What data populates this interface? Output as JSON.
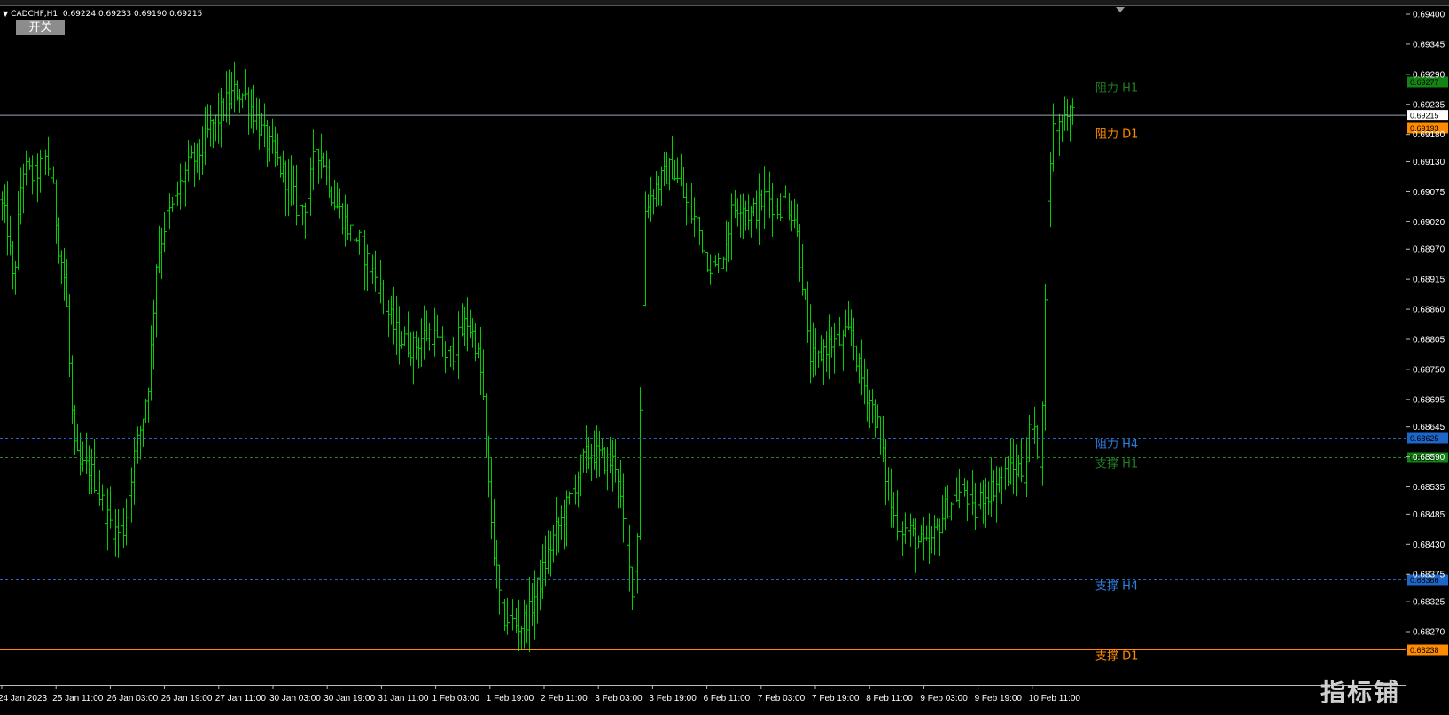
{
  "chart_header": {
    "symbol": "CADCHF,H1",
    "ohlc": "0.69224 0.69233 0.69190 0.69215",
    "toggle_label": "开关"
  },
  "watermark_text": "指标铺",
  "chart_data": {
    "type": "ohlc",
    "title": "CADCHF,H1",
    "ylim": [
      0.68175,
      0.69405
    ],
    "y_ticks": [
      "0.69400",
      "0.69345",
      "0.69290",
      "0.69235",
      "0.69180",
      "0.69130",
      "0.69075",
      "0.69020",
      "0.68970",
      "0.68915",
      "0.68860",
      "0.68805",
      "0.68750",
      "0.68695",
      "0.68645",
      "0.68590",
      "0.68535",
      "0.68485",
      "0.68430",
      "0.68375",
      "0.68325",
      "0.68270"
    ],
    "x_ticks": [
      "24 Jan 2023",
      "25 Jan 11:00",
      "26 Jan 03:00",
      "26 Jan 19:00",
      "27 Jan 11:00",
      "30 Jan 03:00",
      "30 Jan 19:00",
      "31 Jan 11:00",
      "1 Feb 03:00",
      "1 Feb 19:00",
      "2 Feb 11:00",
      "3 Feb 03:00",
      "3 Feb 19:00",
      "6 Feb 11:00",
      "7 Feb 03:00",
      "7 Feb 19:00",
      "8 Feb 11:00",
      "9 Feb 03:00",
      "9 Feb 19:00",
      "10 Feb 11:00"
    ],
    "current_price": "0.69215",
    "levels": [
      {
        "name": "阻力 H1",
        "value": "0.69277",
        "color": "#1e8a1e",
        "style": "dashed",
        "label_color": "#1f7f1f",
        "box_color": "#148214"
      },
      {
        "name": "阻力 D1",
        "value": "0.69193",
        "color": "#ff8c00",
        "style": "solid",
        "label_color": "#ff8c00",
        "box_color": "#ff8c00"
      },
      {
        "name": "阻力 H4",
        "value": "0.68625",
        "color": "#1e66c8",
        "style": "dashed",
        "label_color": "#2f7fe0",
        "box_color": "#1e66c8"
      },
      {
        "name": "支撑 H1",
        "value": "0.68590",
        "color": "#1e8a1e",
        "style": "dashed",
        "label_color": "#1f7f1f",
        "box_color": "#148214"
      },
      {
        "name": "支撑 H4",
        "value": "0.68366",
        "color": "#1e66c8",
        "style": "dashed",
        "label_color": "#2f7fe0",
        "box_color": "#1e66c8"
      },
      {
        "name": "支撑 D1",
        "value": "0.68238",
        "color": "#ff8c00",
        "style": "solid",
        "label_color": "#ff8c00",
        "box_color": "#ff8c00"
      }
    ],
    "bar_color": "#00d000",
    "anchors": [
      [
        0,
        0.6906
      ],
      [
        8,
        0.6901
      ],
      [
        15,
        0.689
      ],
      [
        25,
        0.6912
      ],
      [
        38,
        0.691
      ],
      [
        50,
        0.6914
      ],
      [
        58,
        0.691
      ],
      [
        66,
        0.6898
      ],
      [
        74,
        0.689
      ],
      [
        80,
        0.687
      ],
      [
        84,
        0.686
      ],
      [
        90,
        0.6857
      ],
      [
        100,
        0.6857
      ],
      [
        110,
        0.6853
      ],
      [
        120,
        0.6848
      ],
      [
        132,
        0.6845
      ],
      [
        140,
        0.6846
      ],
      [
        150,
        0.6858
      ],
      [
        160,
        0.6866
      ],
      [
        168,
        0.6874
      ],
      [
        176,
        0.6895
      ],
      [
        186,
        0.6902
      ],
      [
        196,
        0.6905
      ],
      [
        206,
        0.691
      ],
      [
        216,
        0.6913
      ],
      [
        226,
        0.6915
      ],
      [
        236,
        0.6919
      ],
      [
        246,
        0.6921
      ],
      [
        256,
        0.6924
      ],
      [
        266,
        0.6926
      ],
      [
        276,
        0.6925
      ],
      [
        286,
        0.6922
      ],
      [
        296,
        0.6918
      ],
      [
        306,
        0.6915
      ],
      [
        316,
        0.6912
      ],
      [
        326,
        0.6909
      ],
      [
        336,
        0.6904
      ],
      [
        346,
        0.6906
      ],
      [
        356,
        0.6916
      ],
      [
        366,
        0.6913
      ],
      [
        376,
        0.6906
      ],
      [
        386,
        0.6903
      ],
      [
        396,
        0.69
      ],
      [
        406,
        0.6898
      ],
      [
        416,
        0.6894
      ],
      [
        426,
        0.6891
      ],
      [
        436,
        0.6886
      ],
      [
        446,
        0.6882
      ],
      [
        456,
        0.688
      ],
      [
        466,
        0.6879
      ],
      [
        476,
        0.6881
      ],
      [
        486,
        0.6882
      ],
      [
        496,
        0.6879
      ],
      [
        506,
        0.6877
      ],
      [
        516,
        0.688
      ],
      [
        526,
        0.6884
      ],
      [
        536,
        0.688
      ],
      [
        544,
        0.6872
      ],
      [
        550,
        0.6855
      ],
      [
        558,
        0.684
      ],
      [
        566,
        0.683
      ],
      [
        576,
        0.6829
      ],
      [
        586,
        0.6828
      ],
      [
        596,
        0.683
      ],
      [
        606,
        0.6835
      ],
      [
        616,
        0.684
      ],
      [
        626,
        0.6845
      ],
      [
        636,
        0.6848
      ],
      [
        646,
        0.6853
      ],
      [
        656,
        0.6858
      ],
      [
        666,
        0.686
      ],
      [
        676,
        0.6859
      ],
      [
        686,
        0.6858
      ],
      [
        696,
        0.6858
      ],
      [
        704,
        0.6845
      ],
      [
        712,
        0.6835
      ],
      [
        718,
        0.684
      ],
      [
        722,
        0.687
      ],
      [
        728,
        0.6905
      ],
      [
        738,
        0.6908
      ],
      [
        748,
        0.691
      ],
      [
        758,
        0.6912
      ],
      [
        766,
        0.6909
      ],
      [
        776,
        0.6904
      ],
      [
        786,
        0.6902
      ],
      [
        796,
        0.6896
      ],
      [
        806,
        0.6893
      ],
      [
        816,
        0.6896
      ],
      [
        826,
        0.6904
      ],
      [
        836,
        0.6906
      ],
      [
        846,
        0.6903
      ],
      [
        856,
        0.6905
      ],
      [
        866,
        0.6907
      ],
      [
        876,
        0.6904
      ],
      [
        886,
        0.6906
      ],
      [
        896,
        0.6903
      ],
      [
        906,
        0.689
      ],
      [
        912,
        0.6878
      ],
      [
        920,
        0.6876
      ],
      [
        930,
        0.6879
      ],
      [
        940,
        0.688
      ],
      [
        950,
        0.688
      ],
      [
        960,
        0.6882
      ],
      [
        970,
        0.6874
      ],
      [
        980,
        0.687
      ],
      [
        990,
        0.6865
      ],
      [
        1000,
        0.6855
      ],
      [
        1008,
        0.6848
      ],
      [
        1018,
        0.6846
      ],
      [
        1028,
        0.6845
      ],
      [
        1038,
        0.6843
      ],
      [
        1048,
        0.6842
      ],
      [
        1058,
        0.6846
      ],
      [
        1068,
        0.685
      ],
      [
        1078,
        0.6852
      ],
      [
        1088,
        0.6853
      ],
      [
        1098,
        0.6848
      ],
      [
        1108,
        0.6852
      ],
      [
        1118,
        0.6853
      ],
      [
        1128,
        0.6855
      ],
      [
        1138,
        0.6856
      ],
      [
        1148,
        0.6857
      ],
      [
        1156,
        0.6856
      ],
      [
        1162,
        0.6865
      ],
      [
        1168,
        0.6862
      ],
      [
        1175,
        0.6858
      ],
      [
        1180,
        0.6895
      ],
      [
        1184,
        0.6911
      ],
      [
        1188,
        0.6919
      ],
      [
        1196,
        0.692
      ],
      [
        1204,
        0.6923
      ],
      [
        1212,
        0.6921
      ]
    ]
  }
}
